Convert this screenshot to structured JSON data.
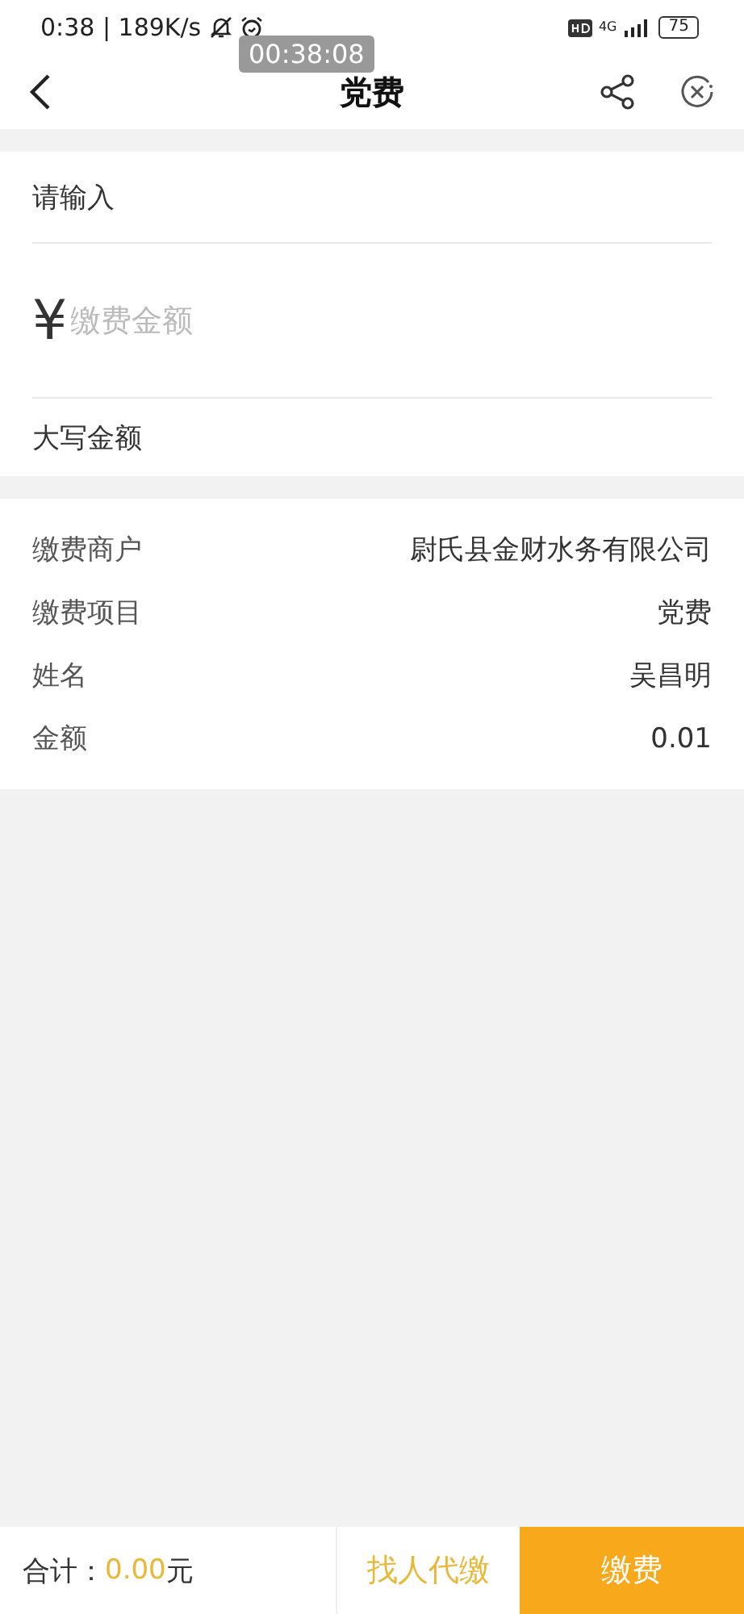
{
  "status_bar": {
    "time": "0:38",
    "separator": "|",
    "speed": "189K/s",
    "network": "4G",
    "battery": "75"
  },
  "recording_badge": "00:38:08",
  "header": {
    "title": "党费"
  },
  "input_section": {
    "label": "请输入",
    "currency": "¥",
    "placeholder": "缴费金额",
    "uppercase_label": "大写金额"
  },
  "details": [
    {
      "label": "缴费商户",
      "value": "尉氏县金财水务有限公司"
    },
    {
      "label": "缴费项目",
      "value": "党费"
    },
    {
      "label": "姓名",
      "value": "吴昌明"
    },
    {
      "label": "金额",
      "value": "0.01"
    }
  ],
  "footer": {
    "total_label": "合计：",
    "total_amount": "0.00",
    "total_unit": "元",
    "proxy_button": "找人代缴",
    "pay_button": "缴费"
  }
}
